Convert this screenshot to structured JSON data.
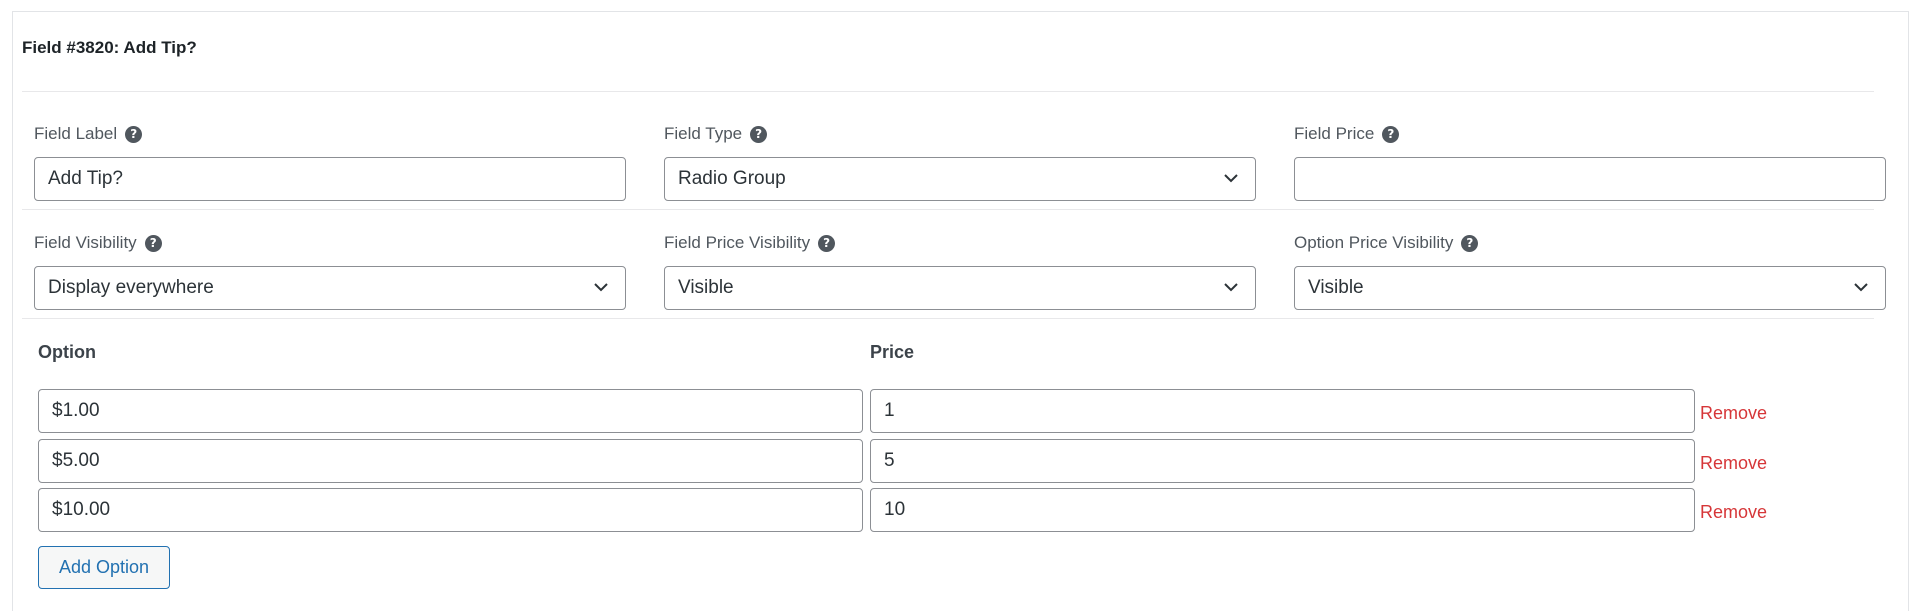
{
  "field_header": {
    "title": "Field #3820: Add Tip?"
  },
  "row1": {
    "field_label": {
      "label": "Field Label",
      "value": "Add Tip?"
    },
    "field_type": {
      "label": "Field Type",
      "value": "Radio Group"
    },
    "field_price": {
      "label": "Field Price",
      "value": ""
    }
  },
  "row2": {
    "field_visibility": {
      "label": "Field Visibility",
      "value": "Display everywhere"
    },
    "field_price_visibility": {
      "label": "Field Price Visibility",
      "value": "Visible"
    },
    "option_price_visibility": {
      "label": "Option Price Visibility",
      "value": "Visible"
    }
  },
  "options_table": {
    "col_option": "Option",
    "col_price": "Price",
    "rows": [
      {
        "option": "$1.00",
        "price": "1",
        "remove": "Remove"
      },
      {
        "option": "$5.00",
        "price": "5",
        "remove": "Remove"
      },
      {
        "option": "$10.00",
        "price": "10",
        "remove": "Remove"
      }
    ],
    "add_label": "Add Option"
  },
  "colors": {
    "remove": "#d63638",
    "button_accent": "#2271b1",
    "help_icon": "#50575e"
  },
  "icons": {
    "help": "question-circle-icon",
    "dropdown": "chevron-down-icon"
  }
}
